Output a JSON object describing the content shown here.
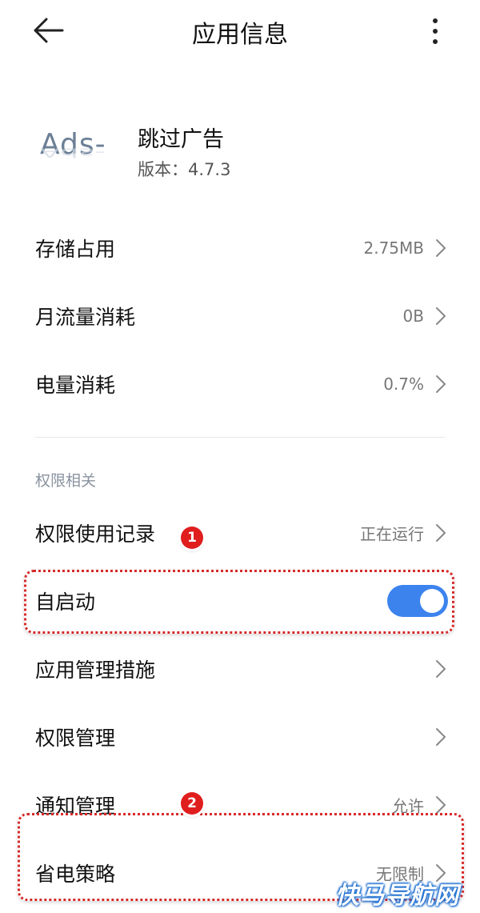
{
  "header": {
    "title": "应用信息",
    "back_icon": "arrow-left-icon",
    "more_icon": "more-vertical-icon"
  },
  "app": {
    "icon_text": "Ads-",
    "name": "跳过广告",
    "version": "版本：4.7.3"
  },
  "usage_rows": [
    {
      "label": "存储占用",
      "value": "2.75MB"
    },
    {
      "label": "月流量消耗",
      "value": "0B"
    },
    {
      "label": "电量消耗",
      "value": "0.7%"
    }
  ],
  "permissions": {
    "section_title": "权限相关",
    "rows": [
      {
        "label": "权限使用记录",
        "value": "正在运行"
      },
      {
        "label": "自启动",
        "toggle_on": true
      },
      {
        "label": "应用管理措施",
        "value": ""
      },
      {
        "label": "权限管理",
        "value": ""
      },
      {
        "label": "通知管理",
        "value": "允许"
      },
      {
        "label": "省电策略",
        "value": "无限制"
      }
    ]
  },
  "annotations": {
    "marker_1": "1",
    "marker_2": "2",
    "highlight_color": "#d62a2a"
  },
  "colors": {
    "accent": "#3c83ee",
    "marker": "#e01e1e"
  },
  "watermark": "快马导航网"
}
